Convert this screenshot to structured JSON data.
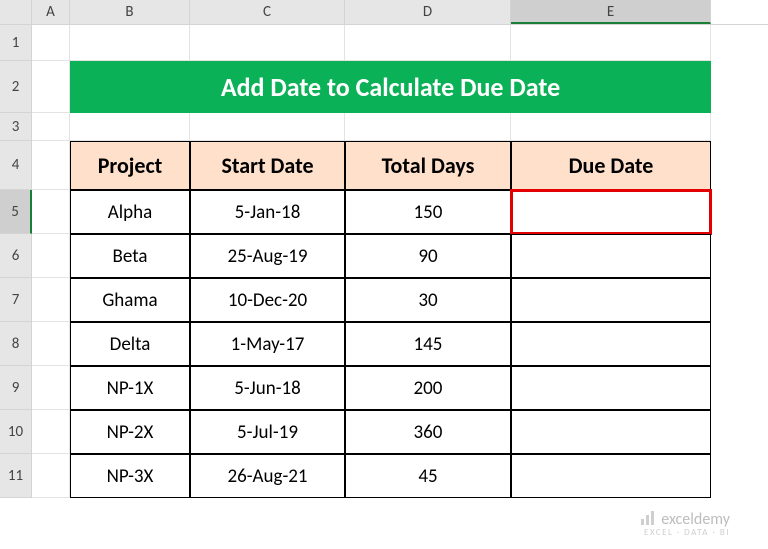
{
  "columns": [
    "A",
    "B",
    "C",
    "D",
    "E"
  ],
  "rows": [
    "1",
    "2",
    "3",
    "4",
    "5",
    "6",
    "7",
    "8",
    "9",
    "10",
    "11"
  ],
  "selected_col": "E",
  "selected_row": "5",
  "banner": "Add Date to Calculate Due Date",
  "headers": {
    "project": "Project",
    "start": "Start Date",
    "days": "Total Days",
    "due": "Due Date"
  },
  "data": [
    {
      "project": "Alpha",
      "start": "5-Jan-18",
      "days": "150",
      "due": ""
    },
    {
      "project": "Beta",
      "start": "25-Aug-19",
      "days": "90",
      "due": ""
    },
    {
      "project": "Ghama",
      "start": "10-Dec-20",
      "days": "30",
      "due": ""
    },
    {
      "project": "Delta",
      "start": "1-May-17",
      "days": "145",
      "due": ""
    },
    {
      "project": "NP-1X",
      "start": "5-Jun-18",
      "days": "200",
      "due": ""
    },
    {
      "project": "NP-2X",
      "start": "5-Jul-19",
      "days": "360",
      "due": ""
    },
    {
      "project": "NP-3X",
      "start": "26-Aug-21",
      "days": "45",
      "due": ""
    }
  ],
  "watermark": {
    "brand": "exceldemy",
    "tag": "EXCEL · DATA · BI"
  }
}
